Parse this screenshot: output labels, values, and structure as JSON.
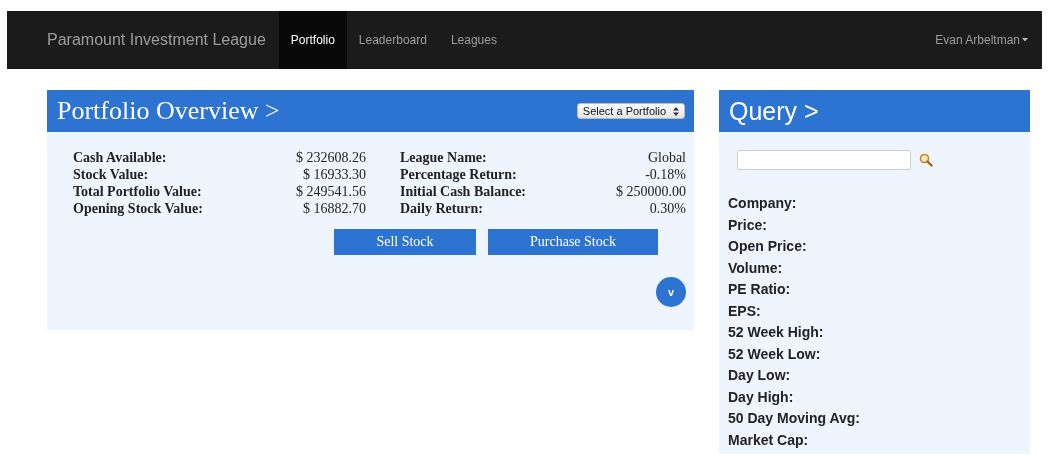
{
  "navbar": {
    "brand": "Paramount Investment League",
    "tabs": [
      {
        "label": "Portfolio",
        "selected": true
      },
      {
        "label": "Leaderboard",
        "selected": false
      },
      {
        "label": "Leagues",
        "selected": false
      }
    ],
    "user": "Evan Arbeltman"
  },
  "portfolio": {
    "title": "Portfolio Overview >",
    "select": "Select a Portfolio",
    "left": [
      {
        "label": "Cash Available:",
        "value": "$ 232608.26"
      },
      {
        "label": "Stock Value:",
        "value": "$ 16933.30"
      },
      {
        "label": "Total Portfolio Value:",
        "value": "$ 249541.56"
      },
      {
        "label": "Opening Stock Value:",
        "value": "$ 16882.70"
      }
    ],
    "right": [
      {
        "label": "League Name:",
        "value": "Global"
      },
      {
        "label": "Percentage Return:",
        "value": "-0.18%"
      },
      {
        "label": "Initial Cash Balance:",
        "value": "$ 250000.00"
      },
      {
        "label": "Daily Return:",
        "value": "0.30%"
      }
    ],
    "buttons": [
      "Sell Stock",
      "Purchase Stock"
    ],
    "expand": "v"
  },
  "query": {
    "title": "Query >",
    "fields": [
      "Company:",
      "Price:",
      "Open Price:",
      "Volume:",
      "PE Ratio:",
      "EPS:",
      "52 Week High:",
      "52 Week Low:",
      "Day Low:",
      "Day High:",
      "50 Day Moving Avg:",
      "Market Cap:"
    ]
  }
}
